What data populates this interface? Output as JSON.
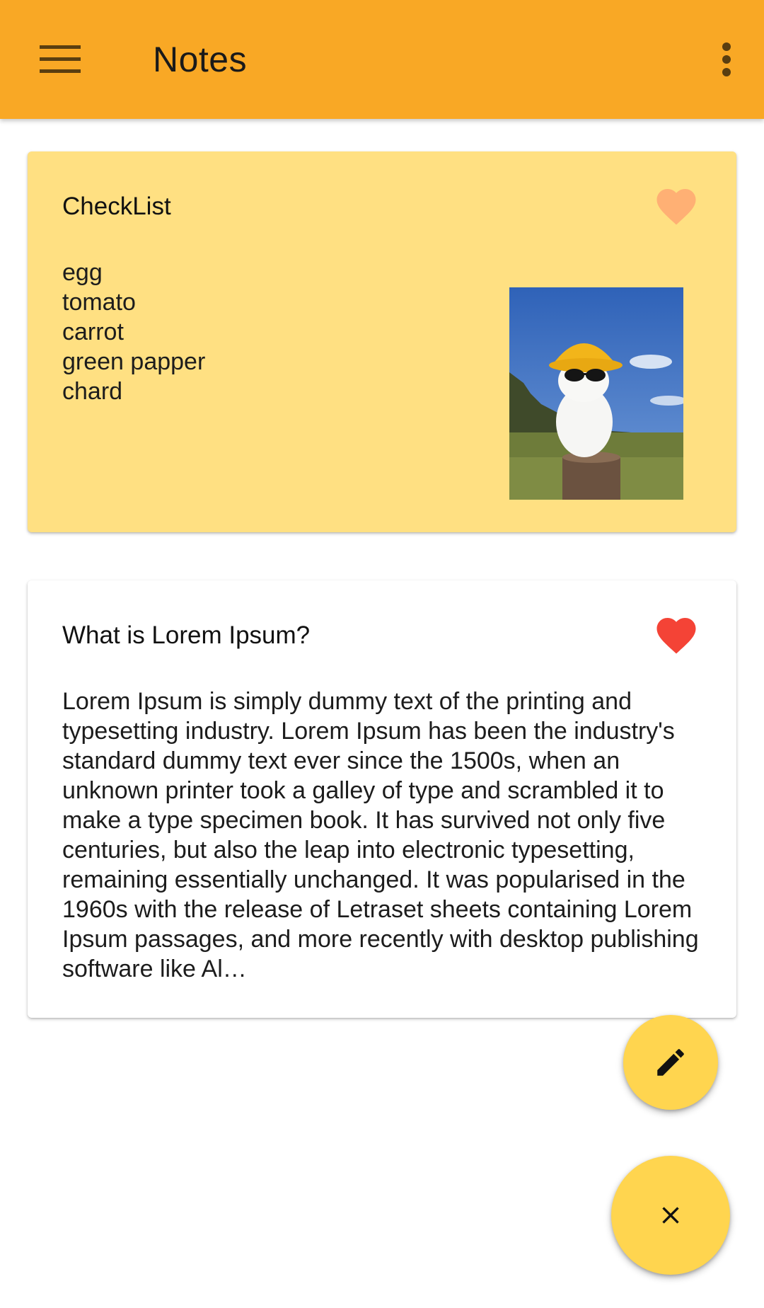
{
  "appbar": {
    "title": "Notes",
    "menu_icon": "hamburger-menu-icon",
    "overflow_icon": "more-vert-icon",
    "color": "#F9A825"
  },
  "notes": [
    {
      "title": "CheckList",
      "favorite": true,
      "heart_color": "#FFB074",
      "background": "#FFE082",
      "items": [
        "egg",
        "tomato",
        "carrot",
        "green papper",
        "chard"
      ],
      "has_image": true
    },
    {
      "title": "What is Lorem Ipsum?",
      "favorite": true,
      "heart_color": "#F44336",
      "background": "#FFFFFF",
      "body": "Lorem Ipsum is simply dummy text of the printing and typesetting industry. Lorem Ipsum has been the industry's standard dummy text ever since the 1500s, when an unknown printer took a galley of type and scrambled it to make a type specimen book. It has survived not only five centuries, but also the leap into electronic typesetting, remaining essentially unchanged. It was popularised in the 1960s with the release of Letraset sheets containing Lorem Ipsum passages, and more recently with desktop publishing software like Al…"
    }
  ],
  "fabs": {
    "edit_icon": "pencil-icon",
    "close_icon": "close-icon",
    "color": "#FFD54F"
  }
}
